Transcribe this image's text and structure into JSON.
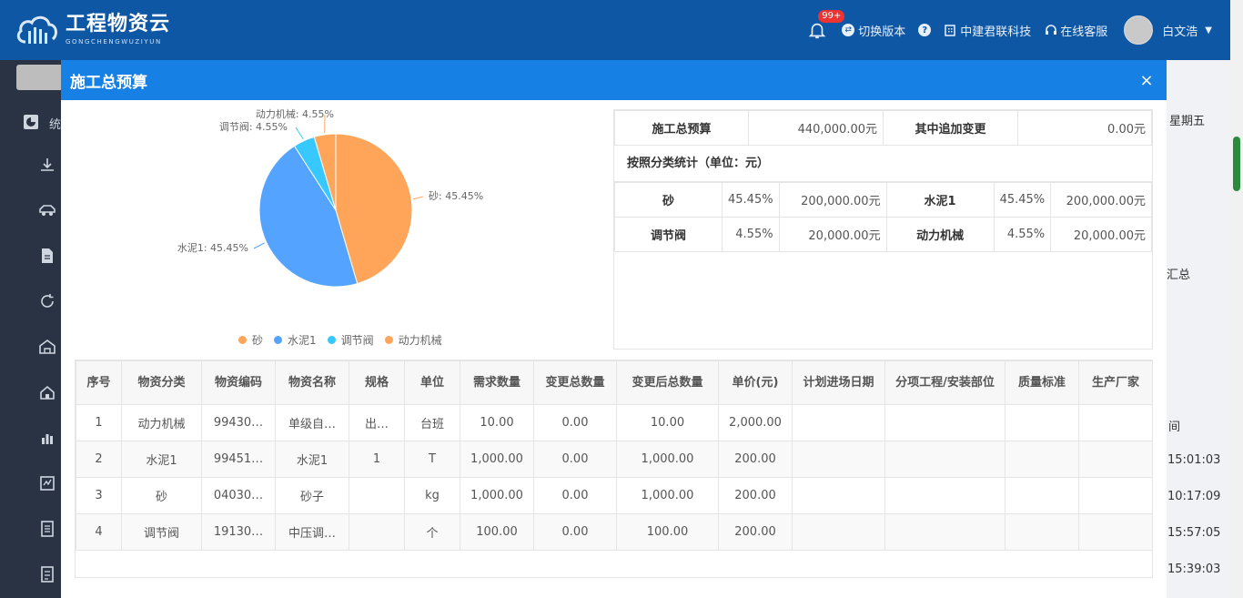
{
  "header": {
    "logo_cn": "工程物资云",
    "logo_en": "GONGCHENGWUZIYUN",
    "badge": "99+",
    "switch_version": "切换版本",
    "company": "中建君联科技",
    "service": "在线客服",
    "user": "白文浩"
  },
  "sidebar": {
    "label": "统"
  },
  "background": {
    "weekday": "星期五",
    "summary": "汇总",
    "time_col": "间",
    "times": [
      "15:01:03",
      "10:17:09",
      "15:57:05",
      "15:39:03"
    ]
  },
  "modal": {
    "title": "施工总预算",
    "close": "×"
  },
  "summary": {
    "total_label": "施工总预算",
    "total_value": "440,000.00元",
    "change_label": "其中追加变更",
    "change_value": "0.00元",
    "section": "按照分类统计（单位：元）",
    "rows": [
      [
        {
          "name": "砂",
          "pct": "45.45%",
          "value": "200,000.00元"
        },
        {
          "name": "水泥1",
          "pct": "45.45%",
          "value": "200,000.00元"
        }
      ],
      [
        {
          "name": "调节阀",
          "pct": "4.55%",
          "value": "20,000.00元"
        },
        {
          "name": "动力机械",
          "pct": "4.55%",
          "value": "20,000.00元"
        }
      ]
    ]
  },
  "chart_data": {
    "type": "pie",
    "slices": [
      {
        "name": "砂",
        "value": 45.45,
        "label": "砂: 45.45%",
        "color": "#ffa55a"
      },
      {
        "name": "水泥1",
        "value": 45.45,
        "label": "水泥1: 45.45%",
        "color": "#54a4ff"
      },
      {
        "name": "调节阀",
        "value": 4.55,
        "label": "调节阀: 4.55%",
        "color": "#37c8ff"
      },
      {
        "name": "动力机械",
        "value": 4.55,
        "label": "动力机械: 4.55%",
        "color": "#ffa55a"
      }
    ],
    "legend": [
      "砂",
      "水泥1",
      "调节阀",
      "动力机械"
    ],
    "legend_position": "bottom"
  },
  "detail": {
    "headers": [
      "序号",
      "物资分类",
      "物资编码",
      "物资名称",
      "规格",
      "单位",
      "需求数量",
      "变更总数量",
      "变更后总数量",
      "单价(元)",
      "计划进场日期",
      "分项工程/安装部位",
      "质量标准",
      "生产厂家"
    ],
    "rows": [
      [
        "1",
        "动力机械",
        "99430…",
        "单级自…",
        "出…",
        "台班",
        "10.00",
        "0.00",
        "10.00",
        "2,000.00",
        "",
        "",
        "",
        ""
      ],
      [
        "2",
        "水泥1",
        "99451…",
        "水泥1",
        "1",
        "T",
        "1,000.00",
        "0.00",
        "1,000.00",
        "200.00",
        "",
        "",
        "",
        ""
      ],
      [
        "3",
        "砂",
        "04030…",
        "砂子",
        "",
        "kg",
        "1,000.00",
        "0.00",
        "1,000.00",
        "200.00",
        "",
        "",
        "",
        ""
      ],
      [
        "4",
        "调节阀",
        "19130…",
        "中压调…",
        "",
        "个",
        "100.00",
        "0.00",
        "100.00",
        "200.00",
        "",
        "",
        "",
        ""
      ]
    ]
  }
}
